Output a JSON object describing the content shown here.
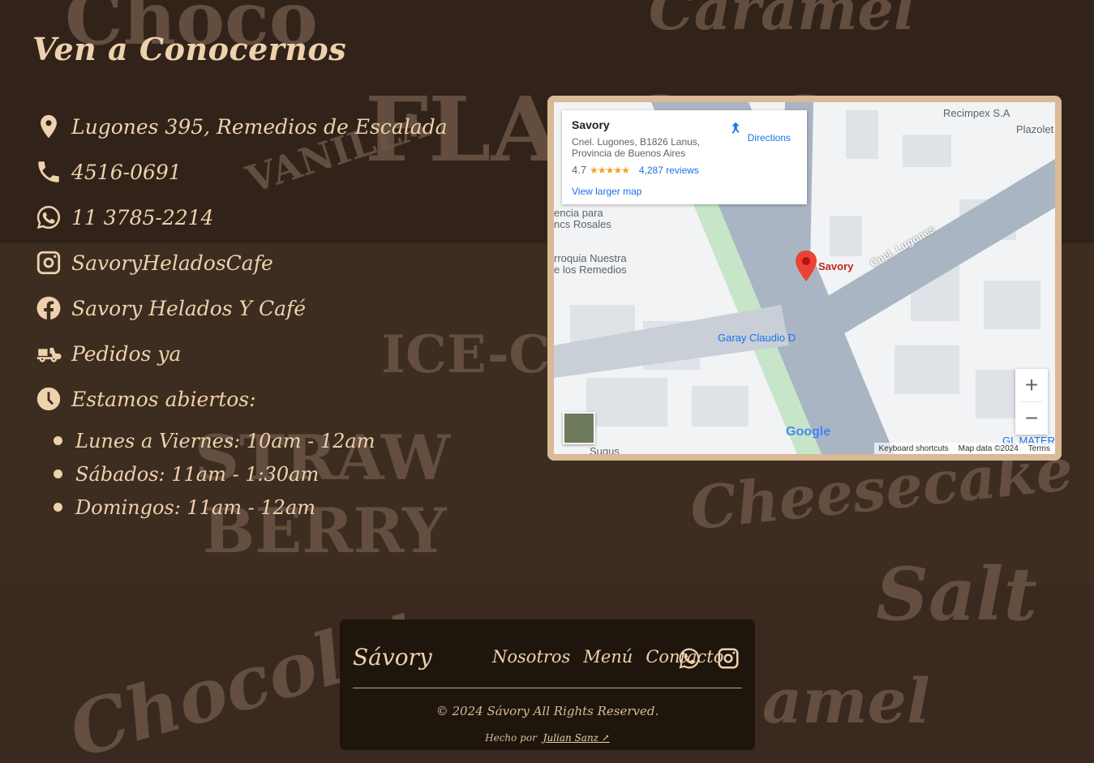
{
  "section": {
    "title": "Ven a Conocernos"
  },
  "contacts": [
    {
      "icon": "location-pin-icon",
      "text": "Lugones 395, Remedios de Escalada"
    },
    {
      "icon": "phone-icon",
      "text": "4516-0691"
    },
    {
      "icon": "whatsapp-icon",
      "text": "11 3785-2214"
    },
    {
      "icon": "instagram-icon",
      "text": "SavoryHeladosCafe"
    },
    {
      "icon": "facebook-icon",
      "text": "Savory Helados Y Café"
    },
    {
      "icon": "delivery-scooter-icon",
      "text": "Pedidos ya"
    },
    {
      "icon": "clock-icon",
      "text": "Estamos abiertos:"
    }
  ],
  "hours": [
    "Lunes a Viernes: 10am - 12am",
    "Sábados: 11am - 1:30am",
    "Domingos: 11am - 12am"
  ],
  "map": {
    "place_name": "Savory",
    "address": "Cnel. Lugones, B1826 Lanus, Provincia de Buenos Aires",
    "rating": "4.7",
    "stars": "★★★★★",
    "reviews": "4,287 reviews",
    "larger_map": "View larger map",
    "directions": "Directions",
    "pin_label": "Savory",
    "street_label": "Cnel. Lugones",
    "poi_recimpex": "Recimpex S.A",
    "poi_plazoleta": "Plazolet",
    "poi_rosales": "encia para\nncs Rosales",
    "poi_parroquia": "rroquia Nuestra\ne los Remedios",
    "poi_garay": "Garay Claudio D",
    "poi_sugus": "Sugus",
    "poi_glmater": "GL MATER",
    "zoom_in": "+",
    "zoom_out": "−",
    "keyboard": "Keyboard shortcuts",
    "map_data": "Map data ©2024",
    "terms": "Terms",
    "google": "Google"
  },
  "footer": {
    "brand": "Sávory",
    "nav": [
      "Nosotros",
      "Menú",
      "Contacto"
    ],
    "copyright": "© 2024 Sávory All Rights Reserved.",
    "made_by_prefix": "Hecho por",
    "made_by_name": "Julian Sanz ↗"
  },
  "background_words": [
    "Choco",
    "Caramel",
    "FLAVORS",
    "VANILLA",
    "ICE-C",
    "STRAW",
    "BERRY",
    "Cheesecake",
    "Salt",
    "Chocolat",
    "amel"
  ]
}
